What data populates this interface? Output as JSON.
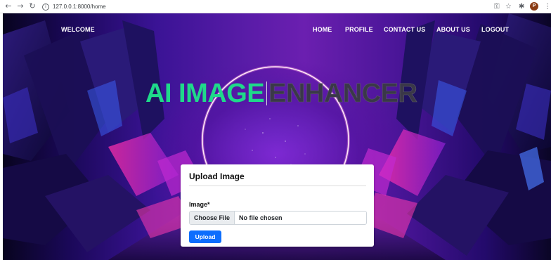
{
  "browser": {
    "url": "127.0.0.1:8000/home",
    "avatar_initial": "P"
  },
  "nav": {
    "brand": "WELCOME",
    "links": [
      "HOME",
      "PROFILE",
      "CONTACT US",
      "ABOUT US",
      "LOGOUT"
    ]
  },
  "hero": {
    "title_part1": "AI IMAGE",
    "title_part2": "ENHANCER"
  },
  "upload_card": {
    "title": "Upload Image",
    "field_label": "Image*",
    "choose_file_label": "Choose File",
    "file_status": "No file chosen",
    "submit_label": "Upload"
  },
  "colors": {
    "accent_green": "#1fd98a",
    "primary_button": "#0d6efd",
    "neon_ring": "#ff9ee0"
  }
}
